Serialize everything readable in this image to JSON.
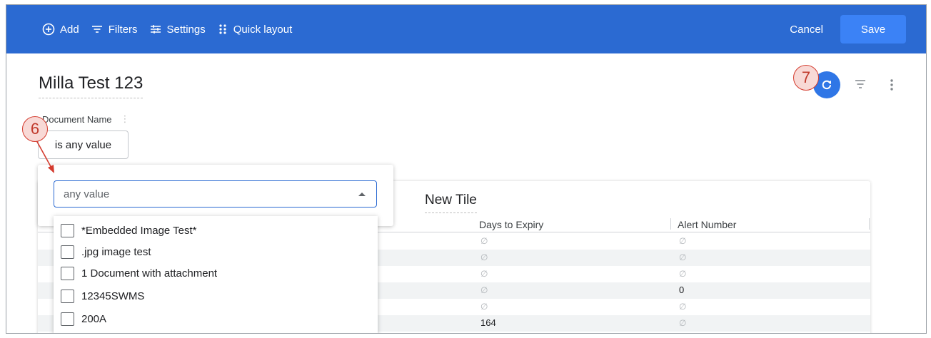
{
  "toolbar": {
    "add_label": "Add",
    "filters_label": "Filters",
    "settings_label": "Settings",
    "quick_layout_label": "Quick layout",
    "cancel_label": "Cancel",
    "save_label": "Save",
    "bg_color": "#2b6ad2",
    "save_color": "#3b82f6"
  },
  "page": {
    "title": "Milla Test 123"
  },
  "actions": {
    "refresh_icon": "refresh-icon",
    "filter_icon": "filter-icon",
    "more_icon": "kebab-menu-icon"
  },
  "annotations": {
    "badge_6": "6",
    "badge_7": "7",
    "color": "#d43b2e"
  },
  "filter": {
    "label": "Document Name",
    "chip_value": "is any value",
    "select_placeholder": "any value",
    "options": [
      "*Embedded Image Test*",
      ".jpg image test",
      "1 Document with attachment",
      "12345SWMS",
      "200A"
    ]
  },
  "tile": {
    "title": "New Tile",
    "columns": [
      "Days to Expiry",
      "Alert Number"
    ],
    "rows": [
      [
        "∅",
        "∅"
      ],
      [
        "∅",
        "∅"
      ],
      [
        "∅",
        "∅"
      ],
      [
        "∅",
        "0"
      ],
      [
        "∅",
        "∅"
      ],
      [
        "164",
        "∅"
      ]
    ]
  }
}
